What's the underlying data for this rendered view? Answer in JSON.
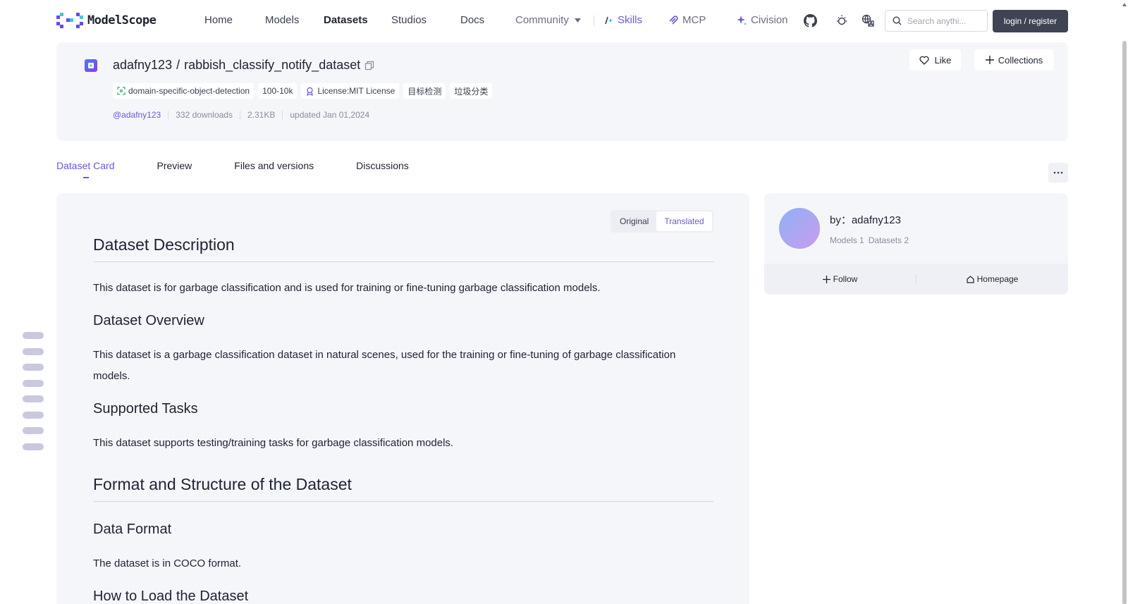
{
  "nav": {
    "logo_text": "ModelScope",
    "items": [
      {
        "label": "Home"
      },
      {
        "label": "Models"
      },
      {
        "label": "Datasets"
      },
      {
        "label": "Studios"
      },
      {
        "label": "Docs"
      },
      {
        "label": "Community"
      }
    ],
    "skills_label": "Skills",
    "mcp_label": "MCP",
    "civision_label": "Civision",
    "search_placeholder": "Search anythi...",
    "login_label": "login / register"
  },
  "dataset": {
    "owner": "adafny123",
    "separator": "/",
    "name": "rabbish_classify_notify_dataset",
    "tags": [
      {
        "label": "domain-specific-object-detection"
      },
      {
        "label": "100-10k"
      },
      {
        "label": "License:MIT License"
      },
      {
        "label": "目标检测"
      },
      {
        "label": "垃圾分类"
      }
    ],
    "meta": {
      "user": "@adafny123",
      "downloads": "332 downloads",
      "size": "2.31KB",
      "updated": "updated Jan 01,2024"
    },
    "like_label": "Like",
    "collections_label": "Collections"
  },
  "tabs": [
    {
      "label": "Dataset Card"
    },
    {
      "label": "Preview"
    },
    {
      "label": "Files and versions"
    },
    {
      "label": "Discussions"
    }
  ],
  "toggle": {
    "original": "Original",
    "translated": "Translated"
  },
  "card": {
    "h1_description": "Dataset Description",
    "p_description": "This dataset is for garbage classification and is used for training or fine-tuning garbage classification models.",
    "h2_overview": "Dataset Overview",
    "p_overview": "This dataset is a garbage classification dataset in natural scenes, used for the training or fine-tuning of garbage classification models.",
    "h2_tasks": "Supported Tasks",
    "p_tasks": "This dataset supports testing/training tasks for garbage classification models.",
    "h1_format": "Format and Structure of the Dataset",
    "h2_data_format": "Data Format",
    "p_data_format": "The dataset is in COCO format.",
    "h2_load": "How to Load the Dataset"
  },
  "author": {
    "name": "by：adafny123",
    "models": "Models 1",
    "datasets": "Datasets 2",
    "follow_label": "Follow",
    "homepage_label": "Homepage"
  },
  "colors": {
    "accent": "#6957ea",
    "panel": "#f5f6fa",
    "login_bg": "#3e4454"
  }
}
